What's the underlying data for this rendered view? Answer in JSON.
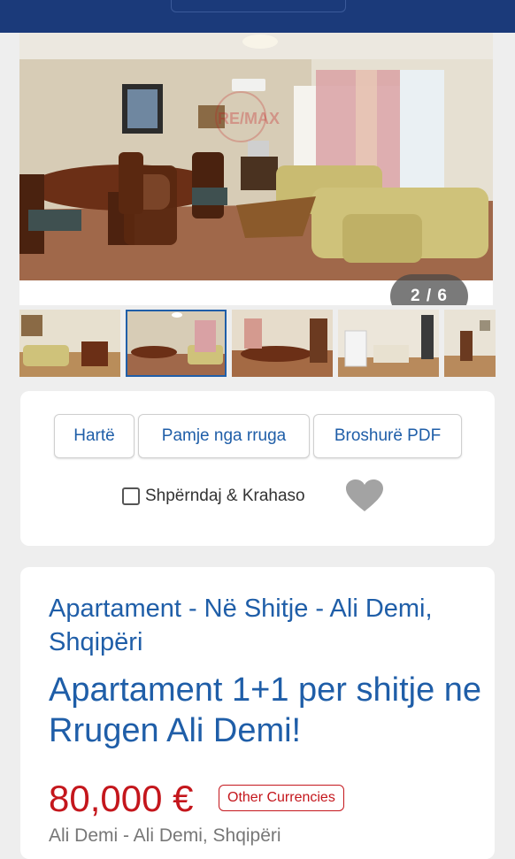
{
  "gallery": {
    "counter": "2 / 6",
    "watermark": "RE/MAX",
    "thumbnails": [
      "thumb-1",
      "thumb-2",
      "thumb-3",
      "thumb-4",
      "thumb-5"
    ],
    "active_index": 1
  },
  "actions": {
    "map_label": "Hartë",
    "street_view_label": "Pamje nga rruga",
    "brochure_label": "Broshurë PDF",
    "share_compare_label": "Shpërndaj & Krahaso"
  },
  "listing": {
    "location": "Apartament - Në Shitje - Ali Demi, Shqipëri",
    "title": "Apartament 1+1 per shitje ne Rrugen Ali Demi!",
    "price": "80,000 €",
    "other_currencies_label": "Other Currencies",
    "address": "Ali Demi - Ali Demi, Shqipëri"
  },
  "colors": {
    "header": "#1b3a7a",
    "link_blue": "#1f5ea8",
    "price_red": "#c4161c"
  }
}
